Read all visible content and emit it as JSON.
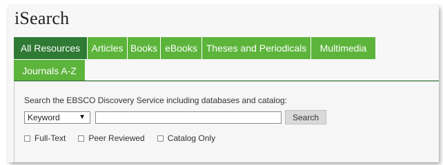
{
  "app": {
    "title": "iSearch"
  },
  "tabs": [
    {
      "label": "All Resources",
      "active": true
    },
    {
      "label": "Articles",
      "active": false
    },
    {
      "label": "Books",
      "active": false
    },
    {
      "label": "eBooks",
      "active": false
    },
    {
      "label": "Theses and Periodicals",
      "active": false
    },
    {
      "label": "Multimedia",
      "active": false
    },
    {
      "label": "Journals A-Z",
      "active": false
    }
  ],
  "search": {
    "description": "Search the EBSCO Discovery Service including databases and catalog:",
    "field_select": "Keyword",
    "query_value": "",
    "button_label": "Search"
  },
  "filters": [
    {
      "label": "Full-Text",
      "checked": false
    },
    {
      "label": "Peer Reviewed",
      "checked": false
    },
    {
      "label": "Catalog Only",
      "checked": false
    }
  ],
  "colors": {
    "tab_green": "#5cb43b",
    "tab_active": "#2f7a34"
  }
}
